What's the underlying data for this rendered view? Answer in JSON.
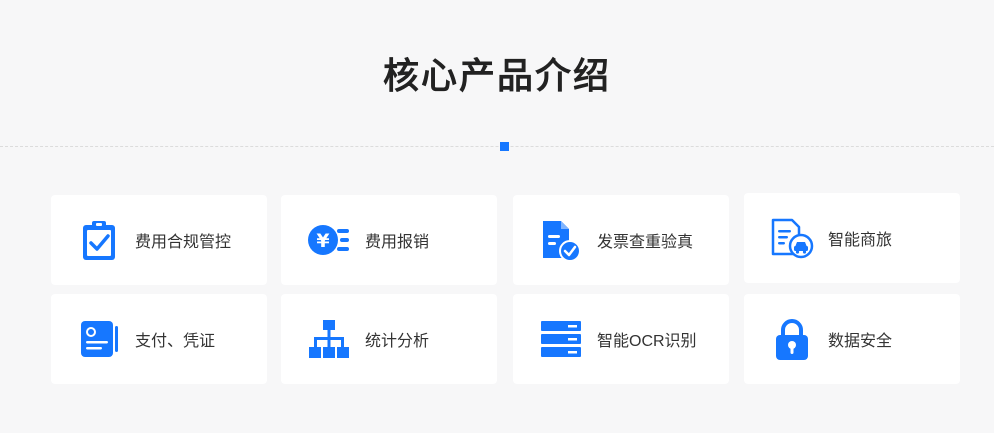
{
  "section": {
    "title": "核心产品介绍"
  },
  "colors": {
    "accent": "#1677ff",
    "background": "#f7f7f8",
    "card": "#ffffff"
  },
  "products": [
    {
      "label": "费用合规管控",
      "icon": "clipboard-check-icon"
    },
    {
      "label": "费用报销",
      "icon": "yen-coin-icon"
    },
    {
      "label": "发票查重验真",
      "icon": "document-check-icon"
    },
    {
      "label": "智能商旅",
      "icon": "document-car-icon"
    },
    {
      "label": "支付、凭证",
      "icon": "voucher-card-icon"
    },
    {
      "label": "统计分析",
      "icon": "org-chart-icon"
    },
    {
      "label": "智能OCR识别",
      "icon": "server-stack-icon"
    },
    {
      "label": "数据安全",
      "icon": "padlock-icon"
    }
  ]
}
